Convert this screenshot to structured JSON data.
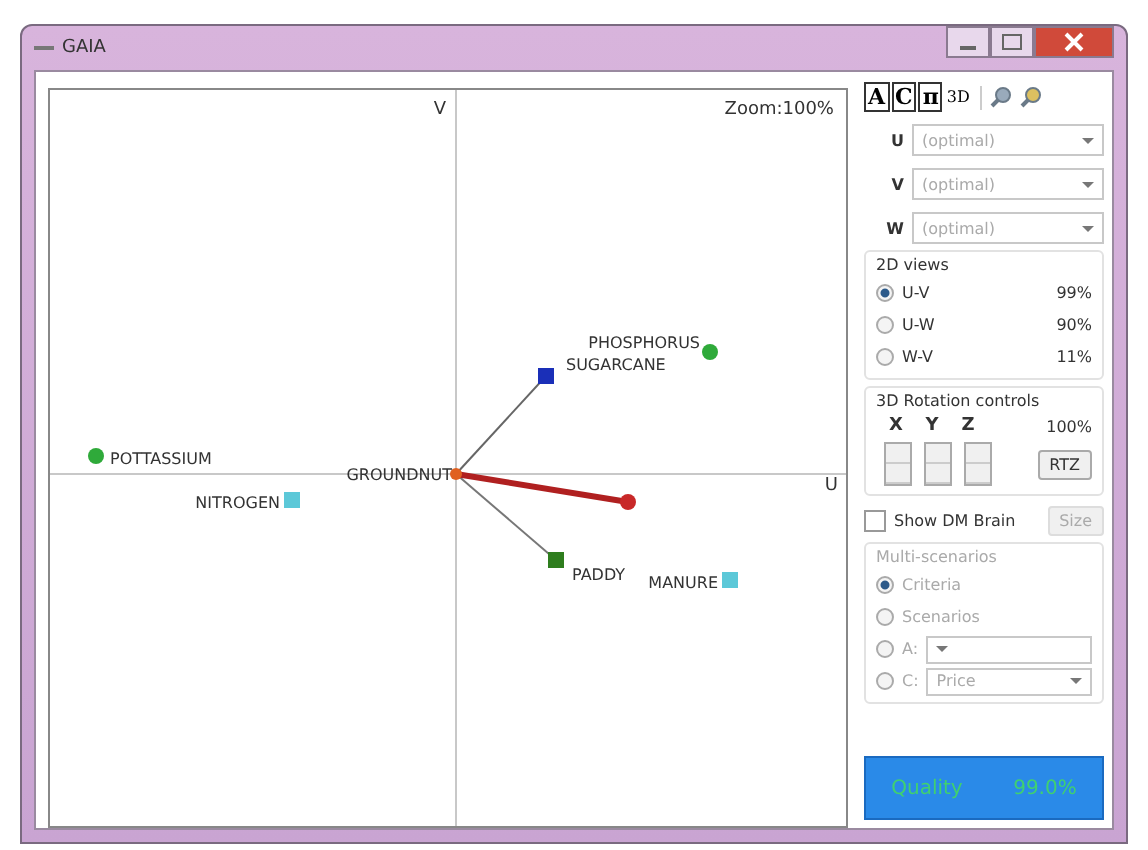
{
  "window": {
    "title": "GAIA"
  },
  "toolbar": [
    {
      "label": "A",
      "kind": "boxed"
    },
    {
      "label": "C",
      "kind": "boxed"
    },
    {
      "label": "π",
      "kind": "boxed"
    },
    {
      "label": "3D",
      "kind": "plain"
    },
    {
      "kind": "zoom-in"
    },
    {
      "kind": "zoom-out"
    }
  ],
  "plot": {
    "zoom": "Zoom:100%",
    "v_axis": "V",
    "u_axis": "U",
    "points": [
      {
        "label": "PHOSPHORUS",
        "kind": "circle",
        "color": "#2faa3a"
      },
      {
        "label": "SUGARCANE",
        "kind": "square",
        "color": "#1a2fb8"
      },
      {
        "label": "POTTASSIUM",
        "kind": "circle",
        "color": "#2faa3a"
      },
      {
        "label": "GROUNDNUT",
        "kind": "origin",
        "color": "#e06020"
      },
      {
        "label": "NITROGEN",
        "kind": "square",
        "color": "#5cc8d8"
      },
      {
        "label": "PADDY",
        "kind": "square",
        "color": "#2e7d1e"
      },
      {
        "label": "MANURE",
        "kind": "square",
        "color": "#5cc8d8"
      }
    ]
  },
  "axes": [
    {
      "label": "U",
      "value": "(optimal)"
    },
    {
      "label": "V",
      "value": "(optimal)"
    },
    {
      "label": "W",
      "value": "(optimal)"
    }
  ],
  "views_2d": {
    "title": "2D views",
    "options": [
      {
        "label": "U-V",
        "value": "99%",
        "selected": true
      },
      {
        "label": "U-W",
        "value": "90%",
        "selected": false
      },
      {
        "label": "W-V",
        "value": "11%",
        "selected": false
      }
    ]
  },
  "rotation": {
    "title": "3D Rotation controls",
    "axes": [
      "X",
      "Y",
      "Z"
    ],
    "value": "100%",
    "button": "RTZ"
  },
  "dm_brain": {
    "label": "Show DM Brain",
    "checked": false,
    "button": "Size"
  },
  "multi": {
    "title": "Multi-scenarios",
    "disabled": true,
    "options": [
      {
        "label": "Criteria",
        "selected": true
      },
      {
        "label": "Scenarios",
        "selected": false
      },
      {
        "label": "A:",
        "selected": false,
        "kind": "dropdown"
      },
      {
        "label": "C:",
        "selected": false,
        "kind": "dropdown",
        "value": "Price"
      }
    ]
  },
  "quality": {
    "label": "Quality",
    "value": "99.0%"
  }
}
